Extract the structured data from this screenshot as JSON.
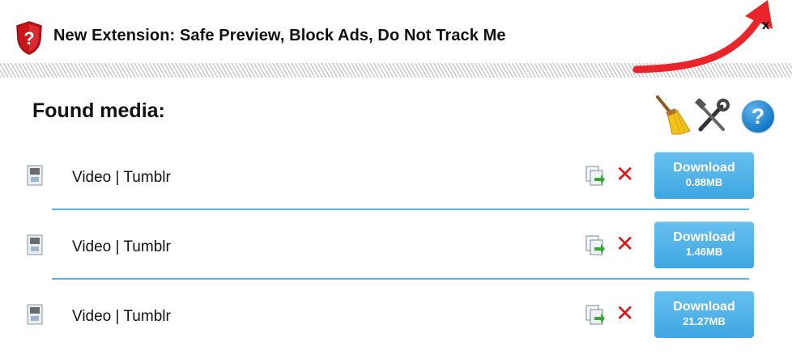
{
  "banner": {
    "text": "New Extension: Safe Preview, Block Ads, Do Not Track Me",
    "close_label": "x",
    "shield_glyph": "?"
  },
  "header": {
    "title": "Found media:",
    "help_label": "?"
  },
  "media": [
    {
      "label": "Video | Tumblr",
      "download_label": "Download",
      "size": "0.88MB"
    },
    {
      "label": "Video | Tumblr",
      "download_label": "Download",
      "size": "1.46MB"
    },
    {
      "label": "Video | Tumblr",
      "download_label": "Download",
      "size": "21.27MB"
    }
  ],
  "colors": {
    "accent_blue": "#4aaee6",
    "separator": "#5ab5d8",
    "delete_red": "#d41c1c",
    "arrow_red": "#e8252a"
  },
  "icons": [
    "shield-icon",
    "close-icon",
    "broom-icon",
    "tools-icon",
    "help-icon",
    "video-file-icon",
    "copy-icon",
    "delete-icon"
  ]
}
